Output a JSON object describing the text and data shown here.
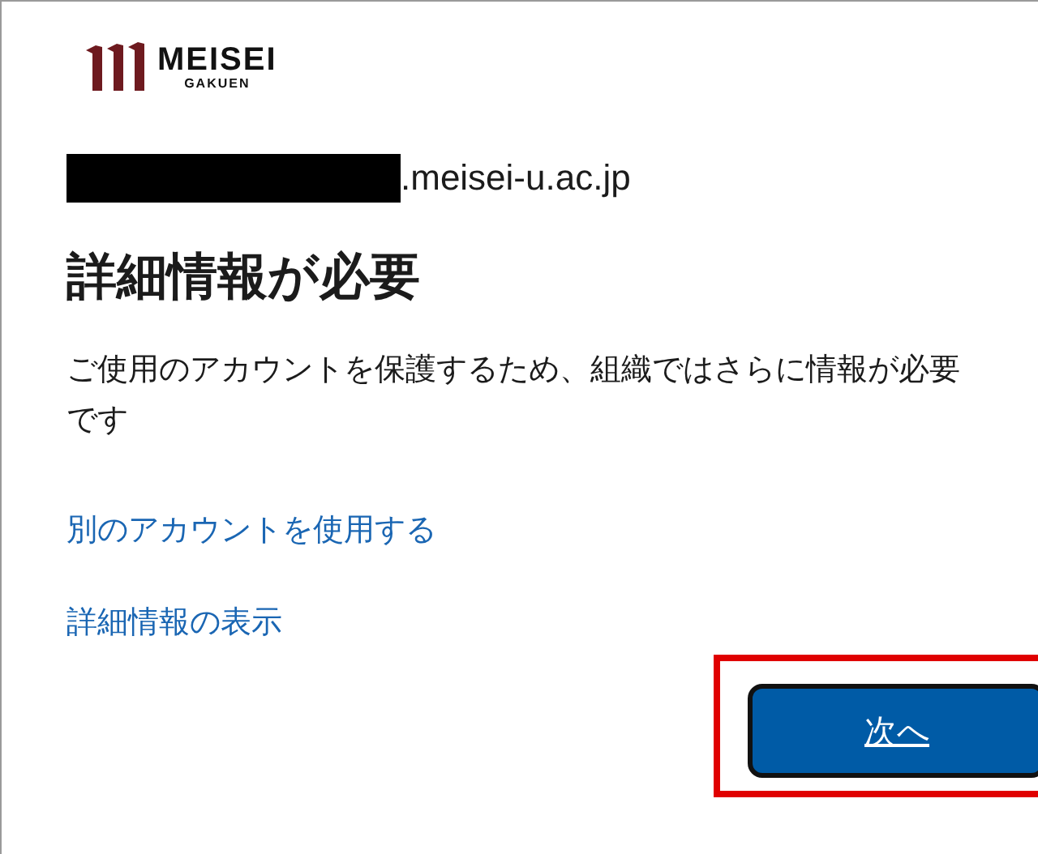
{
  "logo": {
    "name": "MEISEI",
    "subtitle": "GAKUEN"
  },
  "account": {
    "redacted": true,
    "domain": ".meisei-u.ac.jp"
  },
  "title": "詳細情報が必要",
  "message": "ご使用のアカウントを保護するため、組織ではさらに情報が必要です",
  "links": [
    "別のアカウントを使用する",
    "詳細情報の表示"
  ],
  "button": {
    "label": "次へ",
    "highlighted": true
  }
}
